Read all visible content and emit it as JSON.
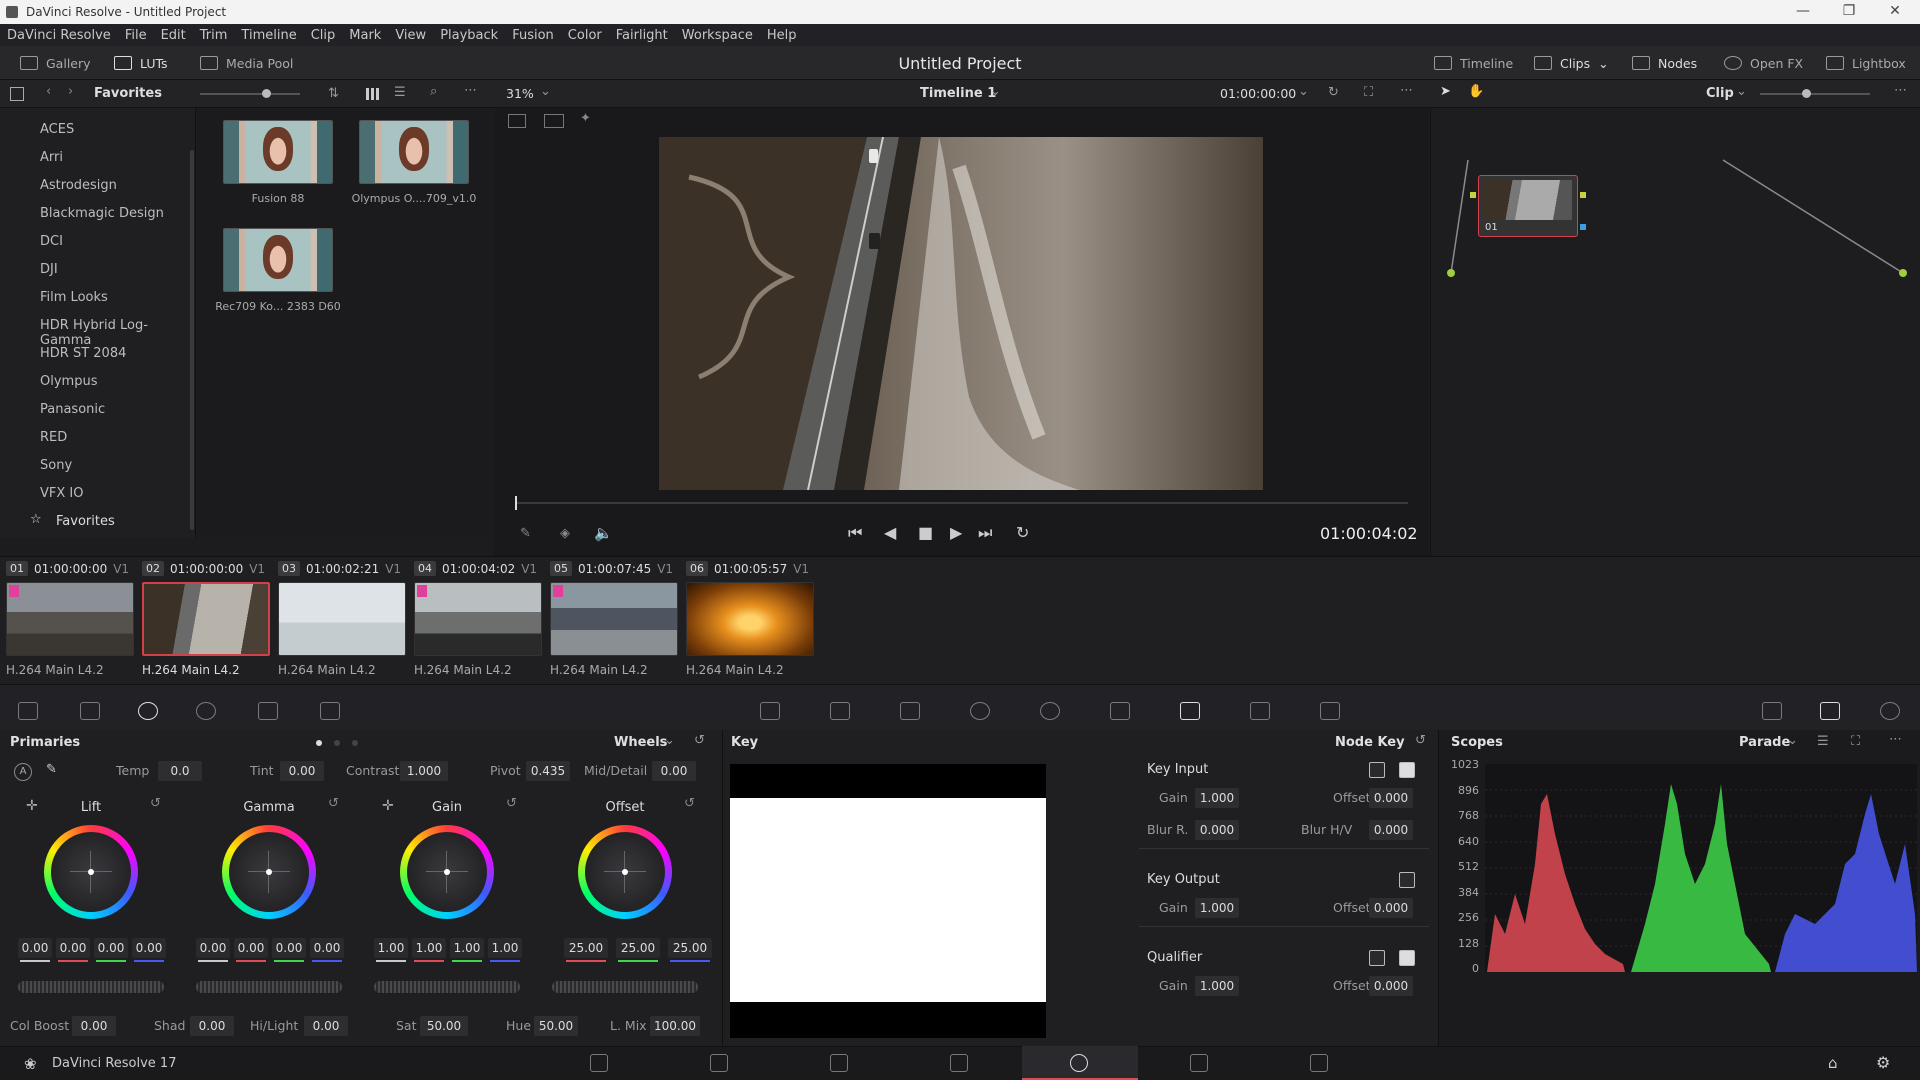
{
  "window": {
    "title": "DaVinci Resolve - Untitled Project"
  },
  "menu": [
    "DaVinci Resolve",
    "File",
    "Edit",
    "Trim",
    "Timeline",
    "Clip",
    "Mark",
    "View",
    "Playback",
    "Fusion",
    "Color",
    "Fairlight",
    "Workspace",
    "Help"
  ],
  "toolbar": {
    "gallery": "Gallery",
    "luts": "LUTs",
    "media_pool": "Media Pool",
    "project_title": "Untitled Project",
    "timeline": "Timeline",
    "clips": "Clips",
    "nodes": "Nodes",
    "open_fx": "Open FX",
    "lightbox": "Lightbox"
  },
  "subbar": {
    "favorites": "Favorites",
    "zoom": "31%",
    "timeline_name": "Timeline 1",
    "timecode": "01:00:00:00",
    "clip_mode": "Clip"
  },
  "lut_categories": [
    "ACES",
    "Arri",
    "Astrodesign",
    "Blackmagic Design",
    "DCI",
    "DJI",
    "Film Looks",
    "HDR Hybrid Log-Gamma",
    "HDR ST 2084",
    "Olympus",
    "Panasonic",
    "RED",
    "Sony",
    "VFX IO",
    "Favorites"
  ],
  "lut_thumbs": [
    "Fusion 88",
    "Olympus O....709_v1.0",
    "Rec709 Ko... 2383 D60"
  ],
  "viewer": {
    "timecode": "01:00:04:02"
  },
  "node": {
    "label": "01"
  },
  "clips": [
    {
      "num": "01",
      "tc": "01:00:00:00",
      "track": "V1",
      "codec": "H.264 Main L4.2"
    },
    {
      "num": "02",
      "tc": "01:00:00:00",
      "track": "V1",
      "codec": "H.264 Main L4.2"
    },
    {
      "num": "03",
      "tc": "01:00:02:21",
      "track": "V1",
      "codec": "H.264 Main L4.2"
    },
    {
      "num": "04",
      "tc": "01:00:04:02",
      "track": "V1",
      "codec": "H.264 Main L4.2"
    },
    {
      "num": "05",
      "tc": "01:00:07:45",
      "track": "V1",
      "codec": "H.264 Main L4.2"
    },
    {
      "num": "06",
      "tc": "01:00:05:57",
      "track": "V1",
      "codec": "H.264 Main L4.2"
    }
  ],
  "primaries": {
    "title": "Primaries",
    "mode": "Wheels",
    "temp_label": "Temp",
    "temp": "0.0",
    "tint_label": "Tint",
    "tint": "0.00",
    "contrast_label": "Contrast",
    "contrast": "1.000",
    "pivot_label": "Pivot",
    "pivot": "0.435",
    "middetail_label": "Mid/Detail",
    "middetail": "0.00",
    "wheels": [
      {
        "name": "Lift",
        "vals": [
          "0.00",
          "0.00",
          "0.00",
          "0.00"
        ]
      },
      {
        "name": "Gamma",
        "vals": [
          "0.00",
          "0.00",
          "0.00",
          "0.00"
        ]
      },
      {
        "name": "Gain",
        "vals": [
          "1.00",
          "1.00",
          "1.00",
          "1.00"
        ]
      },
      {
        "name": "Offset",
        "vals": [
          "25.00",
          "25.00",
          "25.00"
        ]
      }
    ],
    "colboost_label": "Col Boost",
    "colboost": "0.00",
    "shad_label": "Shad",
    "shad": "0.00",
    "hilight_label": "Hi/Light",
    "hilight": "0.00",
    "sat_label": "Sat",
    "sat": "50.00",
    "hue_label": "Hue",
    "hue": "50.00",
    "lmix_label": "L. Mix",
    "lmix": "100.00"
  },
  "key": {
    "title": "Key",
    "node_key": "Node Key",
    "key_input": "Key Input",
    "key_output": "Key Output",
    "qualifier": "Qualifier",
    "gain_label": "Gain",
    "offset_label": "Offset",
    "blur_r_label": "Blur R.",
    "blur_hv_label": "Blur H/V",
    "in_gain": "1.000",
    "in_offset": "0.000",
    "blur_r": "0.000",
    "blur_hv": "0.000",
    "out_gain": "1.000",
    "out_offset": "0.000",
    "q_gain": "1.000",
    "q_offset": "0.000"
  },
  "scopes": {
    "title": "Scopes",
    "mode": "Parade",
    "scale": [
      "1023",
      "896",
      "768",
      "640",
      "512",
      "384",
      "256",
      "128",
      "0"
    ]
  },
  "status": {
    "app": "DaVinci Resolve 17"
  }
}
